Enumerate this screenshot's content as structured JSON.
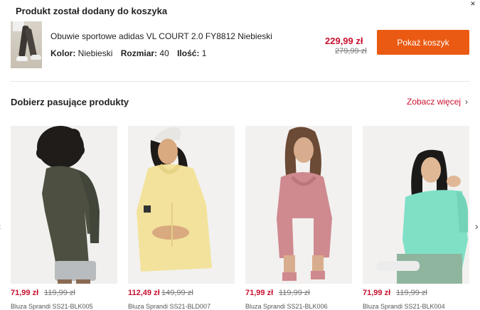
{
  "modal": {
    "title": "Produkt został dodany do koszyka",
    "close_glyph": "×"
  },
  "cart_item": {
    "name": "Obuwie sportowe adidas VL COURT 2.0 FY8812 Niebieski",
    "color_label": "Kolor:",
    "color_value": "Niebieski",
    "size_label": "Rozmiar:",
    "size_value": "40",
    "qty_label": "Ilość:",
    "qty_value": "1",
    "price": "229,99 zł",
    "old_price": "279,99 zł",
    "show_cart_label": "Pokaż koszyk"
  },
  "recommendations": {
    "title": "Dobierz pasujące produkty",
    "see_more_label": "Zobacz więcej",
    "see_more_chevron": "›",
    "prev_glyph": "‹",
    "next_glyph": "›",
    "items": [
      {
        "price": "71,99 zł",
        "old_price": "119,99 zł",
        "name": "Bluza Sprandi SS21-BLK005"
      },
      {
        "price": "112,49 zł",
        "old_price": "149,99 zł",
        "name": "Bluza Sprandi SS21-BLD007"
      },
      {
        "price": "71,99 zł",
        "old_price": "119,99 zł",
        "name": "Bluza Sprandi SS21-BLK006"
      },
      {
        "price": "71,99 zł",
        "old_price": "119,99 zł",
        "name": "Bluza Sprandi SS21-BLK004"
      }
    ]
  },
  "colors": {
    "accent_orange": "#ea5a13",
    "price_red": "#c8102e",
    "hoodie_olive": "#4d5040",
    "hoodie_yellow": "#f3e29b",
    "hoodie_pink": "#cf8a8f",
    "hoodie_mint": "#7fe0c6"
  }
}
